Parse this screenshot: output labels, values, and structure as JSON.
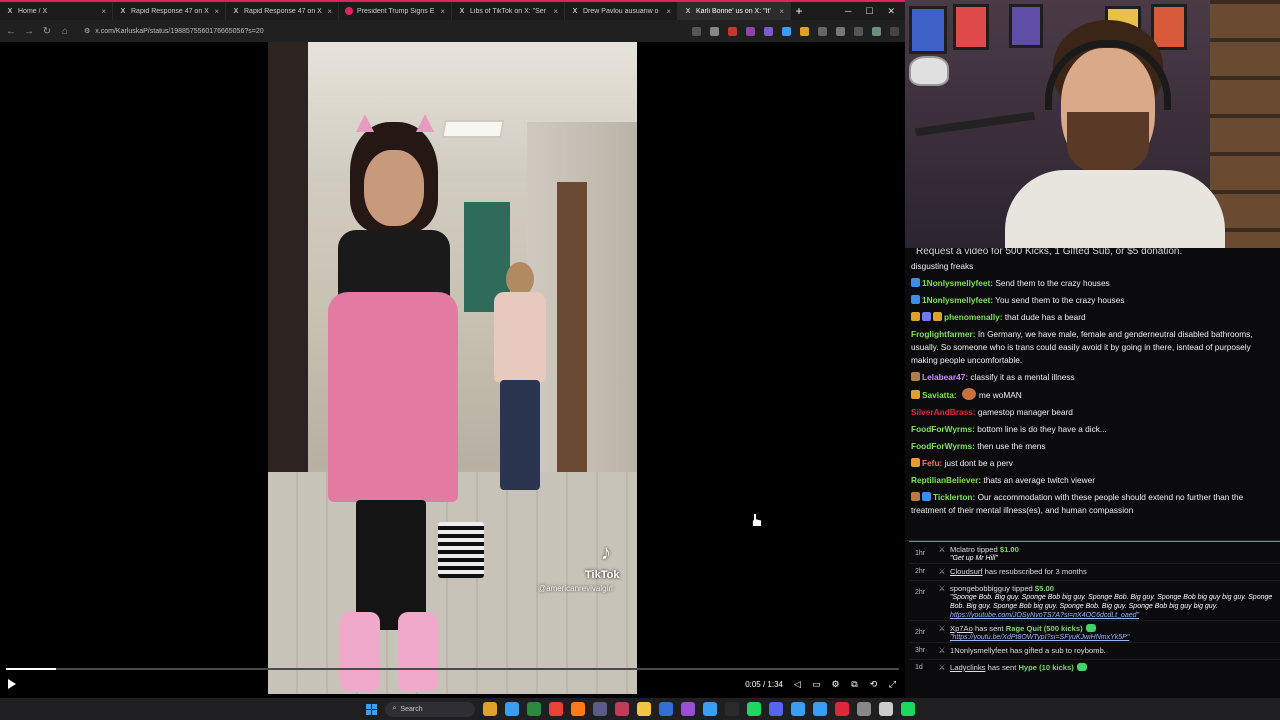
{
  "browser": {
    "tabs": [
      {
        "title": "Home / X",
        "favicon": "x-icon",
        "active": false
      },
      {
        "title": "Rapid Response 47 on X",
        "favicon": "x-icon",
        "active": false
      },
      {
        "title": "Rapid Response 47 on X",
        "favicon": "x-icon",
        "active": false
      },
      {
        "title": "President Trump Signs E",
        "favicon": "youtube-icon",
        "active": false
      },
      {
        "title": "Libs of TikTok on X: \"Ser",
        "favicon": "x-icon",
        "active": false
      },
      {
        "title": "Drew Pavlou ausuanw o",
        "favicon": "x-icon",
        "active": false
      },
      {
        "title": "Karli Bonne' us on X: \"It'",
        "favicon": "x-icon",
        "active": true
      }
    ],
    "new_tab": "+",
    "url": "x.com/KarluskaP/status/1988575560176665056?s=20"
  },
  "video": {
    "tiktok_logo": "♪",
    "tiktok_label": "TikTok",
    "tiktok_handle": "@americanrevivalgirl",
    "time": "0:05 / 1:34",
    "progress": 0.056
  },
  "chat": {
    "banner": "Request a video for 500 Kicks, 1 Gifted Sub, or $5 donation.",
    "messages": [
      {
        "user": "",
        "text": "disgusting freaks",
        "color": "#ffffff",
        "badges": []
      },
      {
        "user": "1Nonlysmellyfeet:",
        "text": "Send them to the crazy houses",
        "color": "#7fe05a",
        "badges": [
          "#3a8ee6"
        ]
      },
      {
        "user": "1Nonlysmellyfeet:",
        "text": "You send them to the crazy houses",
        "color": "#7fe05a",
        "badges": [
          "#3a8ee6"
        ]
      },
      {
        "user": "phenomenally:",
        "text": "that dude has a beard",
        "color": "#7fe05a",
        "badges": [
          "#e0a12a",
          "#6f7bea",
          "#e0a12a"
        ]
      },
      {
        "user": "Froglightfarmer:",
        "text": "In Germany, we have male, female and genderneutral disabled bathrooms, usually. So someone who is trans could easily avoid it by going in there, isntead of purposely making people uncomfortable.",
        "color": "#7fe05a",
        "badges": []
      },
      {
        "user": "Lelabear47:",
        "text": "classify it as a mental illness",
        "color": "#c98bff",
        "badges": [
          "#b07b52"
        ]
      },
      {
        "user": "Saviatta:",
        "text": "me woMAN",
        "color": "#7fe05a",
        "badges": [
          "#e0a12a"
        ],
        "emote": true
      },
      {
        "user": "SilverAndBrass:",
        "text": "gamestop manager beard",
        "color": "#e0283c",
        "badges": []
      },
      {
        "user": "FoodForWyrms:",
        "text": "bottom line is do they have a dick...",
        "color": "#7fe05a",
        "badges": []
      },
      {
        "user": "FoodForWyrms:",
        "text": "then use the mens",
        "color": "#7fe05a",
        "badges": []
      },
      {
        "user": "Fefu:",
        "text": "just dont be a perv",
        "color": "#ff6b6b",
        "badges": [
          "#e0a12a"
        ]
      },
      {
        "user": "ReptilianBeliever:",
        "text": "thats an average twitch viewer",
        "color": "#7fe05a",
        "badges": []
      },
      {
        "user": "Ticklerton:",
        "text": "Our accommodation with these people should extend no further than the treatment of their mental illness(es), and human compassion",
        "color": "#7fe05a",
        "badges": [
          "#b07b52",
          "#3a8ee6"
        ]
      }
    ]
  },
  "events": [
    {
      "time": "1hr",
      "name": "Mclatro",
      "action": "tipped",
      "amount": "$1.00",
      "note": "\"Get up Mr Hill\"",
      "link": "",
      "underline": false,
      "gem": false,
      "rest": ""
    },
    {
      "time": "2hr",
      "name": "Cloudsurf",
      "action": "has resubscribed for 3 months",
      "amount": "",
      "note": "",
      "link": "",
      "underline": true,
      "gem": false,
      "rest": ""
    },
    {
      "time": "2hr",
      "name": "spongebobbigguy",
      "action": "tipped",
      "amount": "$5.00",
      "note": "\"Sponge Bob. Big guy. Sponge Bob big guy. Sponge Bob. Big guy. Sponge Bob big guy big guy. Sponge Bob. Big guy. Sponge Bob big guy. Sponge Bob. Big guy. Sponge Bob big guy big guy.",
      "link": "https://youtube.com/JOSyNvoTS7A?si=nX4OC6dcdLt_oaed\"",
      "underline": false,
      "gem": false,
      "rest": ""
    },
    {
      "time": "2hr",
      "name": "Xp7Ao",
      "action": "has sent",
      "amount": "Rage Quit (500 kicks)",
      "note": "",
      "link": "\"https://youtu.be/XdPt8OWTypI?si=SFyuKJwiHNmxYk5P\"",
      "underline": true,
      "gem": true,
      "rest": ""
    },
    {
      "time": "3hr",
      "name": "1Nonlysmellyfeet",
      "action": "has gifted a sub to",
      "amount": "",
      "note": "",
      "link": "",
      "underline": false,
      "gem": false,
      "rest": "roybomb."
    },
    {
      "time": "1d",
      "name": "Ladyclinks",
      "action": "has sent",
      "amount": "Hype (10 kicks)",
      "note": "",
      "link": "",
      "underline": true,
      "gem": true,
      "rest": ""
    }
  ],
  "taskbar": {
    "search_label": "Search",
    "apps": [
      "#e0a12a",
      "#3a9ef5",
      "#2b8a3e",
      "#ea4335",
      "#ff7a1a",
      "#5b5b8a",
      "#c23b58",
      "#f4c542",
      "#2f6fd6",
      "#9c4dd6",
      "#3a9ef5",
      "#2b2b2b",
      "#1ed760",
      "#5865f2",
      "#3a9ef5",
      "#3a9ef5",
      "#e0283c",
      "#888888",
      "#cccccc",
      "#1ed760"
    ]
  }
}
